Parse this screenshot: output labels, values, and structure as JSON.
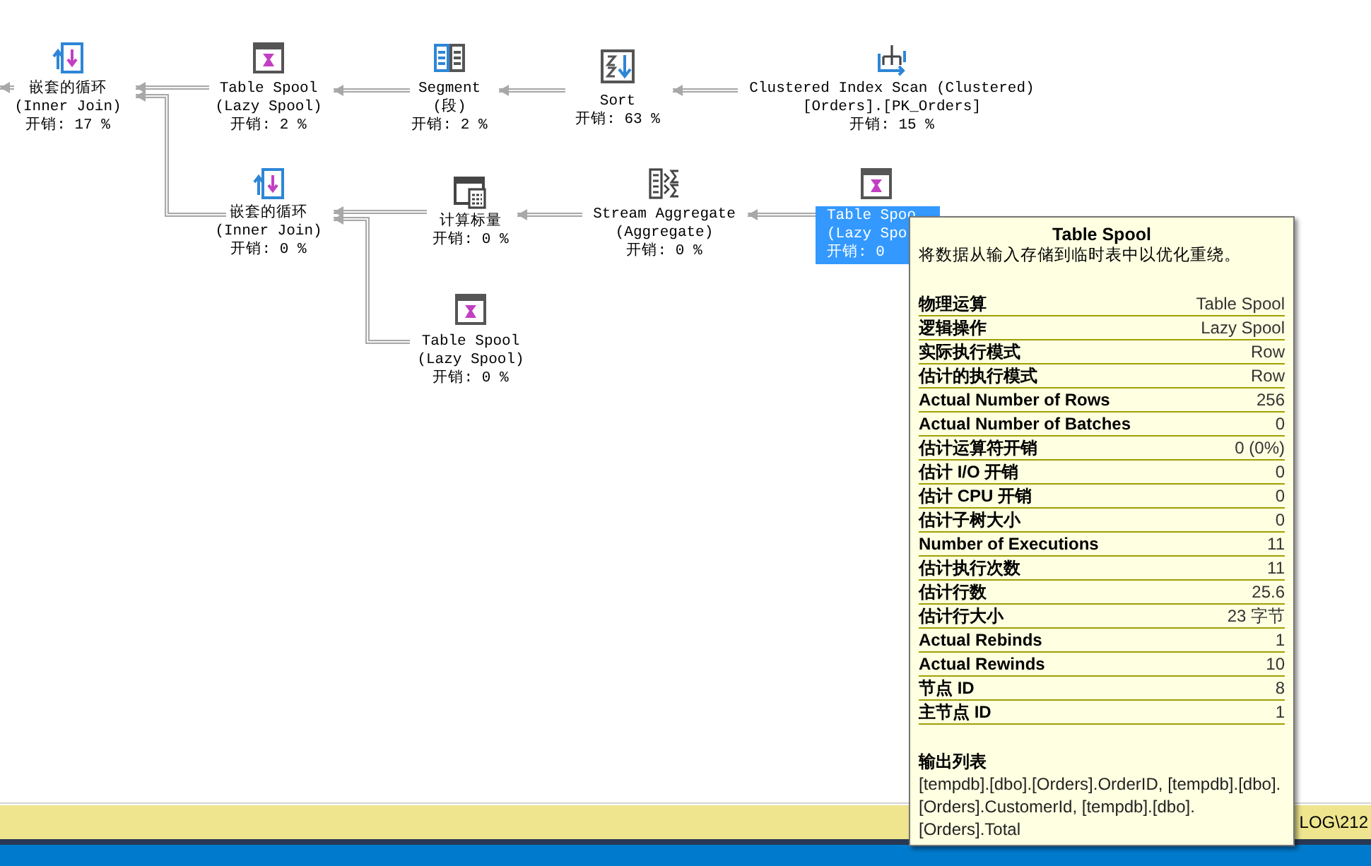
{
  "plan": {
    "nodes": [
      {
        "kind": "nested_loops",
        "selected": false,
        "lines": [
          "嵌套的循环",
          "(Inner Join)",
          "开销: 17 %"
        ]
      },
      {
        "kind": "table_spool",
        "selected": false,
        "lines": [
          "Table Spool",
          "(Lazy Spool)",
          "开销: 2 %"
        ]
      },
      {
        "kind": "segment",
        "selected": false,
        "lines": [
          "Segment",
          "(段)",
          "开销: 2 %"
        ]
      },
      {
        "kind": "sort",
        "selected": false,
        "lines": [
          "Sort",
          "开销: 63 %"
        ]
      },
      {
        "kind": "index_scan",
        "selected": false,
        "lines": [
          "Clustered Index Scan (Clustered)",
          "[Orders].[PK_Orders]",
          "开销: 15 %"
        ]
      },
      {
        "kind": "nested_loops",
        "selected": false,
        "lines": [
          "嵌套的循环",
          "(Inner Join)",
          "开销: 0 %"
        ]
      },
      {
        "kind": "compute_scalar",
        "selected": false,
        "lines": [
          "计算标量",
          "开销: 0 %"
        ]
      },
      {
        "kind": "stream_aggregate",
        "selected": false,
        "lines": [
          "Stream Aggregate",
          "(Aggregate)",
          "开销: 0 %"
        ]
      },
      {
        "kind": "table_spool",
        "selected": true,
        "lines": [
          "Table Spoo",
          "(Lazy Spo",
          "开销: 0"
        ]
      },
      {
        "kind": "table_spool",
        "selected": false,
        "lines": [
          "Table Spool",
          "(Lazy Spool)",
          "开销: 0 %"
        ]
      }
    ]
  },
  "tooltip": {
    "title": "Table Spool",
    "description": "将数据从输入存储到临时表中以优化重绕。",
    "properties": [
      {
        "label": "物理运算",
        "value": "Table Spool"
      },
      {
        "label": "逻辑操作",
        "value": "Lazy Spool"
      },
      {
        "label": "实际执行模式",
        "value": "Row"
      },
      {
        "label": "估计的执行模式",
        "value": "Row"
      },
      {
        "label": "Actual Number of Rows",
        "value": "256"
      },
      {
        "label": "Actual Number of Batches",
        "value": "0"
      },
      {
        "label": "估计运算符开销",
        "value": "0 (0%)"
      },
      {
        "label": "估计 I/O 开销",
        "value": "0"
      },
      {
        "label": "估计 CPU 开销",
        "value": "0"
      },
      {
        "label": "估计子树大小",
        "value": "0"
      },
      {
        "label": "Number of Executions",
        "value": "11"
      },
      {
        "label": "估计执行次数",
        "value": "11"
      },
      {
        "label": "估计行数",
        "value": "25.6"
      },
      {
        "label": "估计行大小",
        "value": "23 字节"
      },
      {
        "label": "Actual Rebinds",
        "value": "1"
      },
      {
        "label": "Actual Rewinds",
        "value": "10"
      },
      {
        "label": "节点 ID",
        "value": "8"
      },
      {
        "label": "主节点 ID",
        "value": "1"
      }
    ],
    "output_heading": "输出列表",
    "output_text": "[tempdb].[dbo].[Orders].OrderID, [tempdb].[dbo].[Orders].CustomerId, [tempdb].[dbo].[Orders].Total"
  },
  "status_bar": {
    "text": "LOG\\212"
  }
}
